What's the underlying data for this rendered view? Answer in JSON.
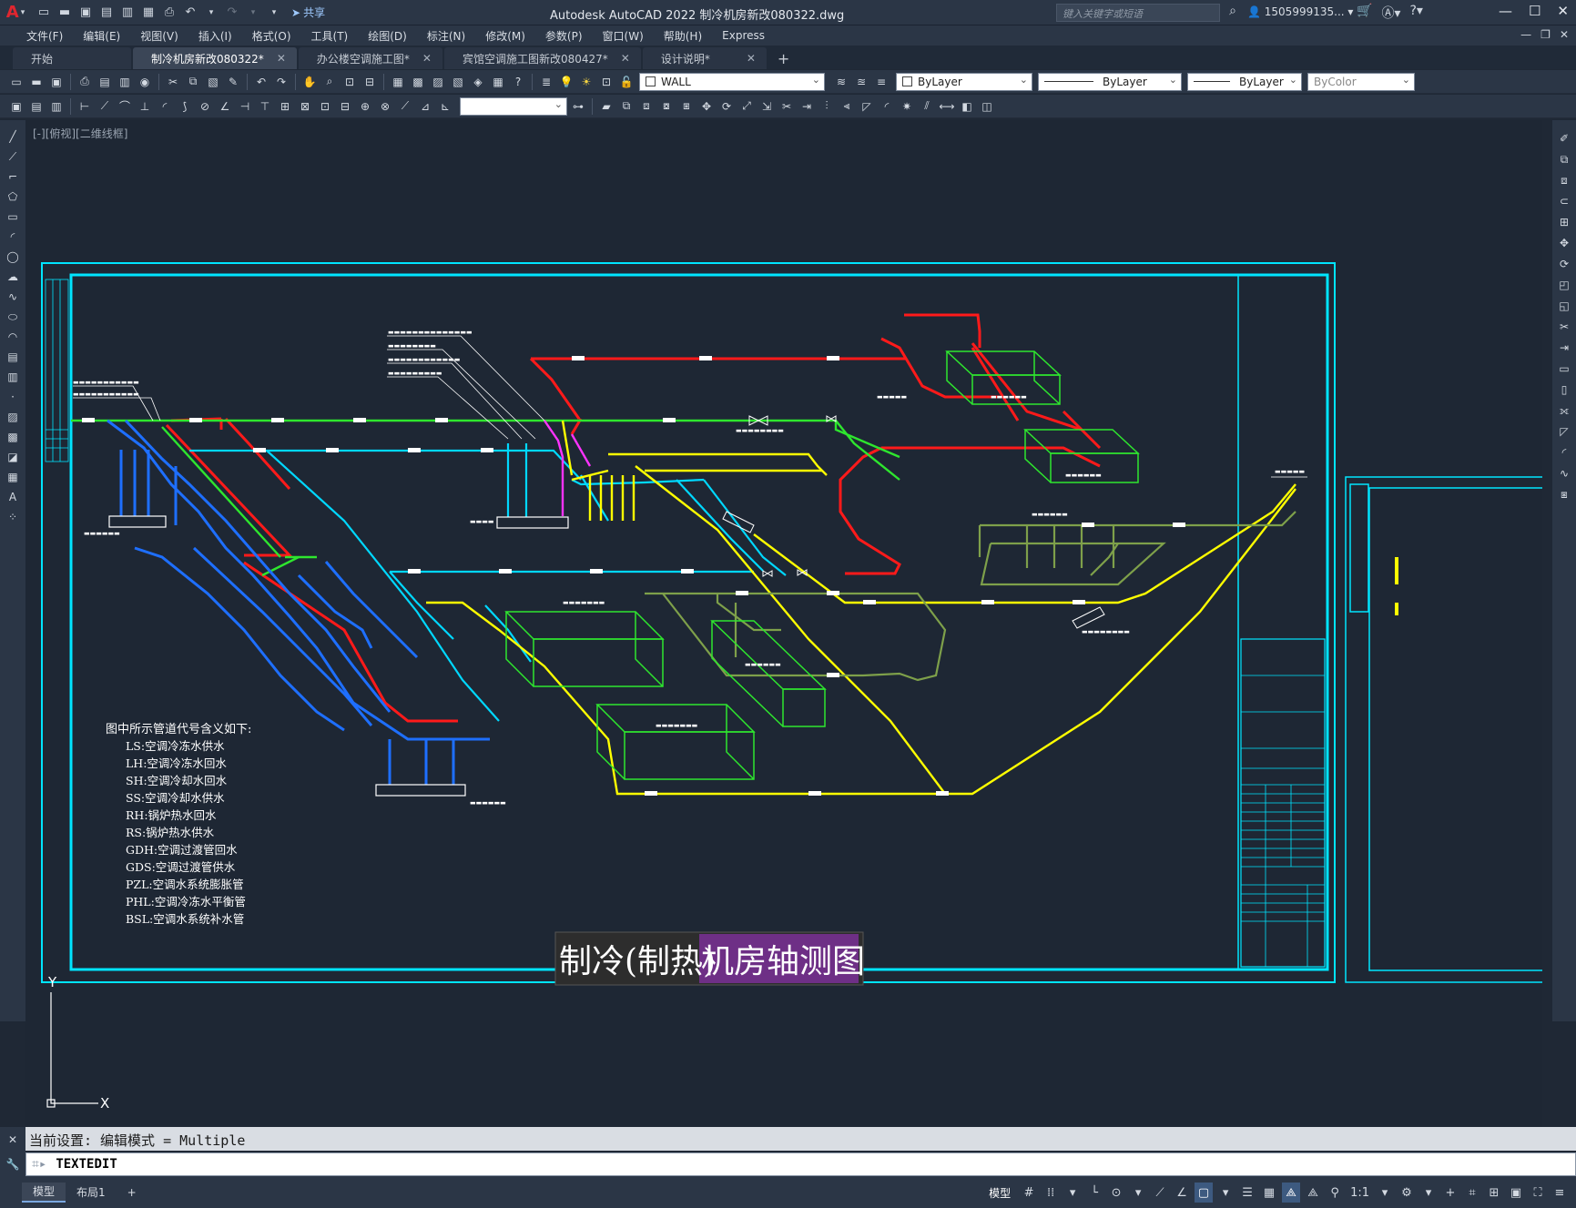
{
  "titlebar": {
    "app_logo": "A",
    "share_label": "共享",
    "title": "Autodesk AutoCAD 2022    制冷机房新改080322.dwg",
    "search_placeholder": "键入关键字或短语",
    "user": "1505999135...",
    "window_controls": [
      "minimize",
      "maximize",
      "close"
    ]
  },
  "menubar": {
    "items": [
      "文件(F)",
      "编辑(E)",
      "视图(V)",
      "插入(I)",
      "格式(O)",
      "工具(T)",
      "绘图(D)",
      "标注(N)",
      "修改(M)",
      "参数(P)",
      "窗口(W)",
      "帮助(H)",
      "Express"
    ]
  },
  "tabs": [
    {
      "label": "开始",
      "active": false,
      "closable": false
    },
    {
      "label": "制冷机房新改080322*",
      "active": true,
      "closable": true
    },
    {
      "label": "办公楼空调施工图*",
      "active": false,
      "closable": true
    },
    {
      "label": "宾馆空调施工图新改080427*",
      "active": false,
      "closable": true
    },
    {
      "label": "设计说明*",
      "active": false,
      "closable": true
    }
  ],
  "properties": {
    "layer": "WALL",
    "color": "ByLayer",
    "linetype": "ByLayer",
    "lineweight": "ByLayer",
    "plotstyle": "ByColor"
  },
  "viewport": {
    "label": "[-][俯视][二维线框]",
    "drawing_title_left": "制冷(制热)",
    "drawing_title_right": "机房轴测图",
    "ucs_y": "Y",
    "ucs_x": "X",
    "legend_title": "图中所示管道代号含义如下:",
    "legend_items": [
      "LS:空调冷冻水供水",
      "LH:空调冷冻水回水",
      "SH:空调冷却水回水",
      "SS:空调冷却水供水",
      "RH:锅炉热水回水",
      "RS:锅炉热水供水",
      "GDH:空调过渡管回水",
      "GDS:空调过渡管供水",
      "PZL:空调水系统膨胀管",
      "PHL:空调冷冻水平衡管",
      "BSL:空调水系统补水管"
    ]
  },
  "command": {
    "history": "当前设置: 编辑模式 = Multiple",
    "prompt_symbol": "⌗▸",
    "input": "TEXTEDIT"
  },
  "statusbar": {
    "layout_tabs": [
      "模型",
      "布局1"
    ],
    "model_label": "模型",
    "scale": "1:1"
  },
  "colors": {
    "background": "#1e2734",
    "frame": "#00e5ff",
    "pipe_red": "#ff1a1a",
    "pipe_green": "#2ee62e",
    "pipe_blue": "#1e6fff",
    "pipe_cyan": "#00d8ff",
    "pipe_yellow": "#ffff00",
    "pipe_magenta": "#ff33ff",
    "pipe_olive": "#7ea04a",
    "title_highlight": "#6e2f86"
  }
}
